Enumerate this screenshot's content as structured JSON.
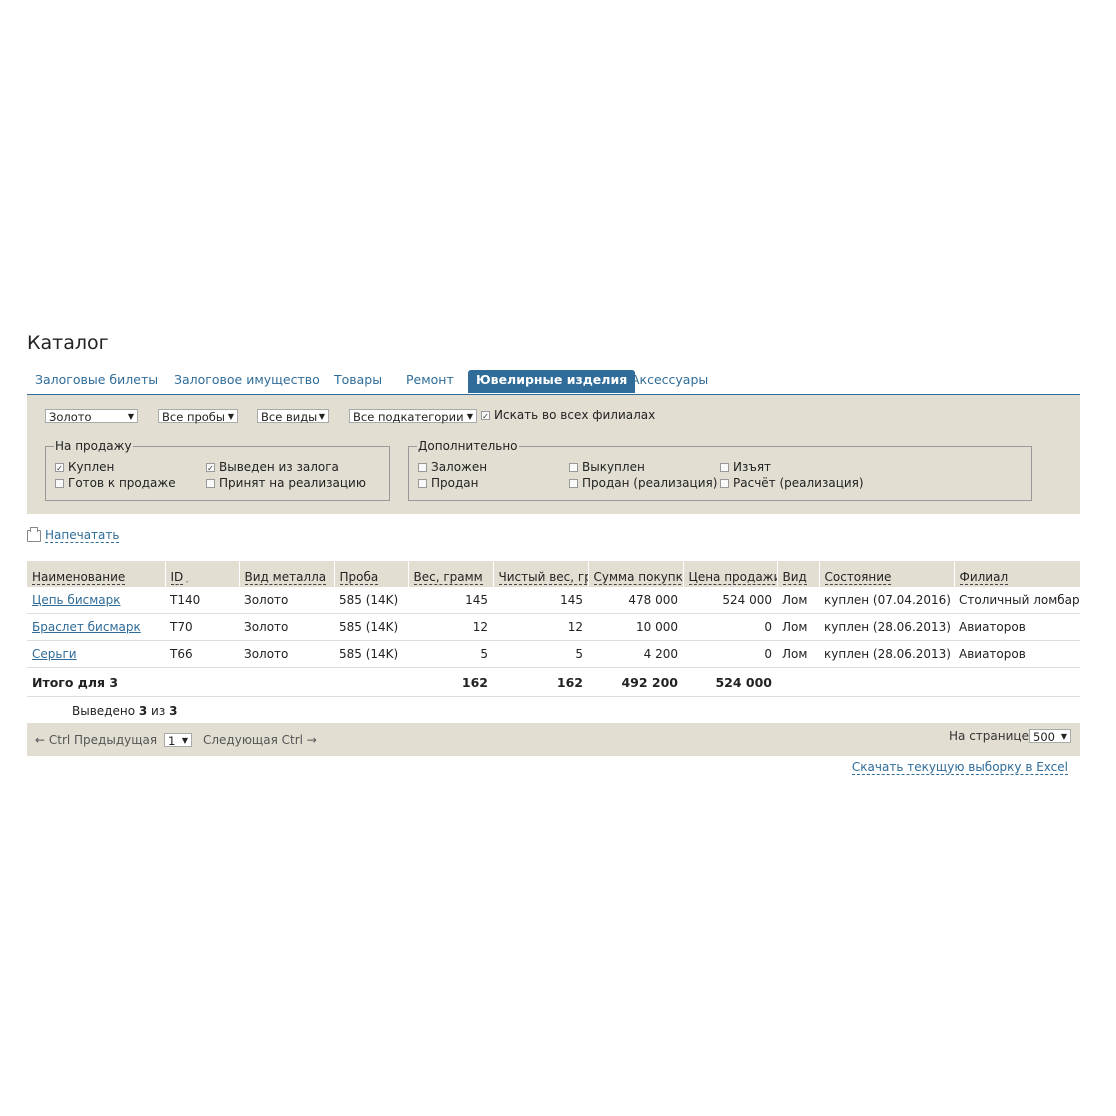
{
  "title": "Каталог",
  "tabs": [
    {
      "label": "Залоговые билеты"
    },
    {
      "label": "Залоговое имущество"
    },
    {
      "label": "Товары"
    },
    {
      "label": "Ремонт"
    },
    {
      "label": "Ювелирные изделия",
      "active": true
    },
    {
      "label": "Аксессуары"
    }
  ],
  "filters": {
    "metal": "Золото",
    "probe": "Все пробы",
    "kind": "Все виды",
    "subcategory": "Все подкатегории",
    "all_branches": {
      "label": "Искать во всех филиалах",
      "checked": true
    },
    "for_sale": {
      "legend": "На продажу",
      "items": [
        {
          "label": "Куплен",
          "checked": true
        },
        {
          "label": "Выведен из залога",
          "checked": true
        },
        {
          "label": "Готов к продаже",
          "checked": false
        },
        {
          "label": "Принят на реализацию",
          "checked": false
        }
      ]
    },
    "extra": {
      "legend": "Дополнительно",
      "items": [
        {
          "label": "Заложен",
          "checked": false
        },
        {
          "label": "Выкуплен",
          "checked": false
        },
        {
          "label": "Изъят",
          "checked": false
        },
        {
          "label": "Продан",
          "checked": false
        },
        {
          "label": "Продан (реализация)",
          "checked": false
        },
        {
          "label": "Расчёт (реализация)",
          "checked": false
        }
      ]
    }
  },
  "print_label": "Напечатать",
  "table": {
    "headers": [
      "Наименование",
      "ID",
      "Вид металла",
      "Проба",
      "Вес, грамм",
      "Чистый вес, гр",
      "Сумма покупки",
      "Цена продажи,",
      "Вид",
      "Состояние",
      "Филиал"
    ],
    "rows": [
      [
        "Цепь бисмарк",
        "T140",
        "Золото",
        "585 (14K)",
        "145",
        "145",
        "478 000",
        "524 000",
        "Лом",
        "куплен (07.04.2016)",
        "Столичный ломбард"
      ],
      [
        "Браслет бисмарк",
        "T70",
        "Золото",
        "585 (14K)",
        "12",
        "12",
        "10 000",
        "0",
        "Лом",
        "куплен (28.06.2013)",
        "Авиаторов"
      ],
      [
        "Серьги",
        "T66",
        "Золото",
        "585 (14K)",
        "5",
        "5",
        "4 200",
        "0",
        "Лом",
        "куплен (28.06.2013)",
        "Авиаторов"
      ]
    ],
    "total": {
      "label": "Итого для 3",
      "weight": "162",
      "net_weight": "162",
      "purchase_sum": "492 200",
      "sale_price": "524 000"
    }
  },
  "shown": {
    "prefix": "Выведено",
    "count": "3",
    "of": "из",
    "total": "3"
  },
  "pager": {
    "prev": "← Ctrl Предыдущая",
    "page": "1",
    "next": "Следующая Ctrl →",
    "per_page_label": "На странице:",
    "per_page": "500"
  },
  "excel_link": "Скачать текущую выборку в Excel",
  "colors": {
    "accent": "#2f6c99",
    "panel": "#e2dfd2"
  }
}
